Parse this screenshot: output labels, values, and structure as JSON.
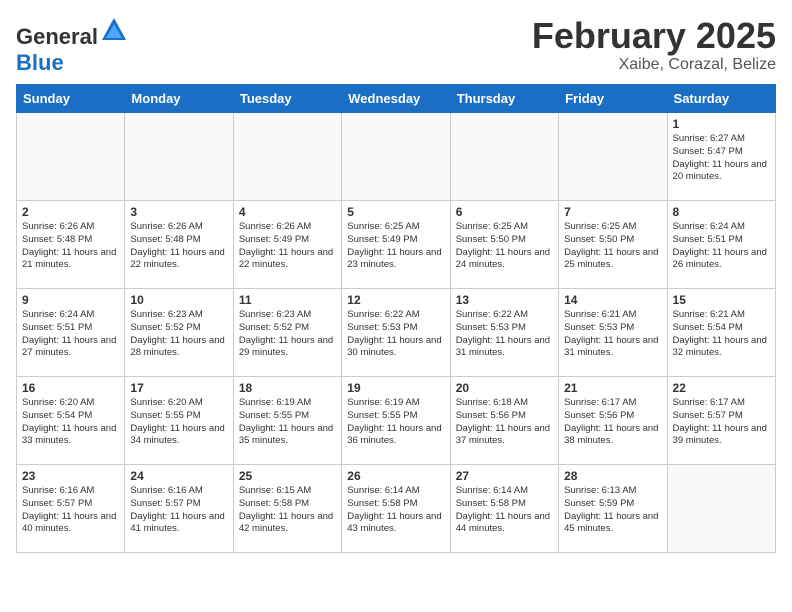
{
  "header": {
    "logo_general": "General",
    "logo_blue": "Blue",
    "title": "February 2025",
    "subtitle": "Xaibe, Corazal, Belize"
  },
  "days_of_week": [
    "Sunday",
    "Monday",
    "Tuesday",
    "Wednesday",
    "Thursday",
    "Friday",
    "Saturday"
  ],
  "weeks": [
    [
      {
        "day": "",
        "info": ""
      },
      {
        "day": "",
        "info": ""
      },
      {
        "day": "",
        "info": ""
      },
      {
        "day": "",
        "info": ""
      },
      {
        "day": "",
        "info": ""
      },
      {
        "day": "",
        "info": ""
      },
      {
        "day": "1",
        "info": "Sunrise: 6:27 AM\nSunset: 5:47 PM\nDaylight: 11 hours and 20 minutes."
      }
    ],
    [
      {
        "day": "2",
        "info": "Sunrise: 6:26 AM\nSunset: 5:48 PM\nDaylight: 11 hours and 21 minutes."
      },
      {
        "day": "3",
        "info": "Sunrise: 6:26 AM\nSunset: 5:48 PM\nDaylight: 11 hours and 22 minutes."
      },
      {
        "day": "4",
        "info": "Sunrise: 6:26 AM\nSunset: 5:49 PM\nDaylight: 11 hours and 22 minutes."
      },
      {
        "day": "5",
        "info": "Sunrise: 6:25 AM\nSunset: 5:49 PM\nDaylight: 11 hours and 23 minutes."
      },
      {
        "day": "6",
        "info": "Sunrise: 6:25 AM\nSunset: 5:50 PM\nDaylight: 11 hours and 24 minutes."
      },
      {
        "day": "7",
        "info": "Sunrise: 6:25 AM\nSunset: 5:50 PM\nDaylight: 11 hours and 25 minutes."
      },
      {
        "day": "8",
        "info": "Sunrise: 6:24 AM\nSunset: 5:51 PM\nDaylight: 11 hours and 26 minutes."
      }
    ],
    [
      {
        "day": "9",
        "info": "Sunrise: 6:24 AM\nSunset: 5:51 PM\nDaylight: 11 hours and 27 minutes."
      },
      {
        "day": "10",
        "info": "Sunrise: 6:23 AM\nSunset: 5:52 PM\nDaylight: 11 hours and 28 minutes."
      },
      {
        "day": "11",
        "info": "Sunrise: 6:23 AM\nSunset: 5:52 PM\nDaylight: 11 hours and 29 minutes."
      },
      {
        "day": "12",
        "info": "Sunrise: 6:22 AM\nSunset: 5:53 PM\nDaylight: 11 hours and 30 minutes."
      },
      {
        "day": "13",
        "info": "Sunrise: 6:22 AM\nSunset: 5:53 PM\nDaylight: 11 hours and 31 minutes."
      },
      {
        "day": "14",
        "info": "Sunrise: 6:21 AM\nSunset: 5:53 PM\nDaylight: 11 hours and 31 minutes."
      },
      {
        "day": "15",
        "info": "Sunrise: 6:21 AM\nSunset: 5:54 PM\nDaylight: 11 hours and 32 minutes."
      }
    ],
    [
      {
        "day": "16",
        "info": "Sunrise: 6:20 AM\nSunset: 5:54 PM\nDaylight: 11 hours and 33 minutes."
      },
      {
        "day": "17",
        "info": "Sunrise: 6:20 AM\nSunset: 5:55 PM\nDaylight: 11 hours and 34 minutes."
      },
      {
        "day": "18",
        "info": "Sunrise: 6:19 AM\nSunset: 5:55 PM\nDaylight: 11 hours and 35 minutes."
      },
      {
        "day": "19",
        "info": "Sunrise: 6:19 AM\nSunset: 5:55 PM\nDaylight: 11 hours and 36 minutes."
      },
      {
        "day": "20",
        "info": "Sunrise: 6:18 AM\nSunset: 5:56 PM\nDaylight: 11 hours and 37 minutes."
      },
      {
        "day": "21",
        "info": "Sunrise: 6:17 AM\nSunset: 5:56 PM\nDaylight: 11 hours and 38 minutes."
      },
      {
        "day": "22",
        "info": "Sunrise: 6:17 AM\nSunset: 5:57 PM\nDaylight: 11 hours and 39 minutes."
      }
    ],
    [
      {
        "day": "23",
        "info": "Sunrise: 6:16 AM\nSunset: 5:57 PM\nDaylight: 11 hours and 40 minutes."
      },
      {
        "day": "24",
        "info": "Sunrise: 6:16 AM\nSunset: 5:57 PM\nDaylight: 11 hours and 41 minutes."
      },
      {
        "day": "25",
        "info": "Sunrise: 6:15 AM\nSunset: 5:58 PM\nDaylight: 11 hours and 42 minutes."
      },
      {
        "day": "26",
        "info": "Sunrise: 6:14 AM\nSunset: 5:58 PM\nDaylight: 11 hours and 43 minutes."
      },
      {
        "day": "27",
        "info": "Sunrise: 6:14 AM\nSunset: 5:58 PM\nDaylight: 11 hours and 44 minutes."
      },
      {
        "day": "28",
        "info": "Sunrise: 6:13 AM\nSunset: 5:59 PM\nDaylight: 11 hours and 45 minutes."
      },
      {
        "day": "",
        "info": ""
      }
    ]
  ]
}
